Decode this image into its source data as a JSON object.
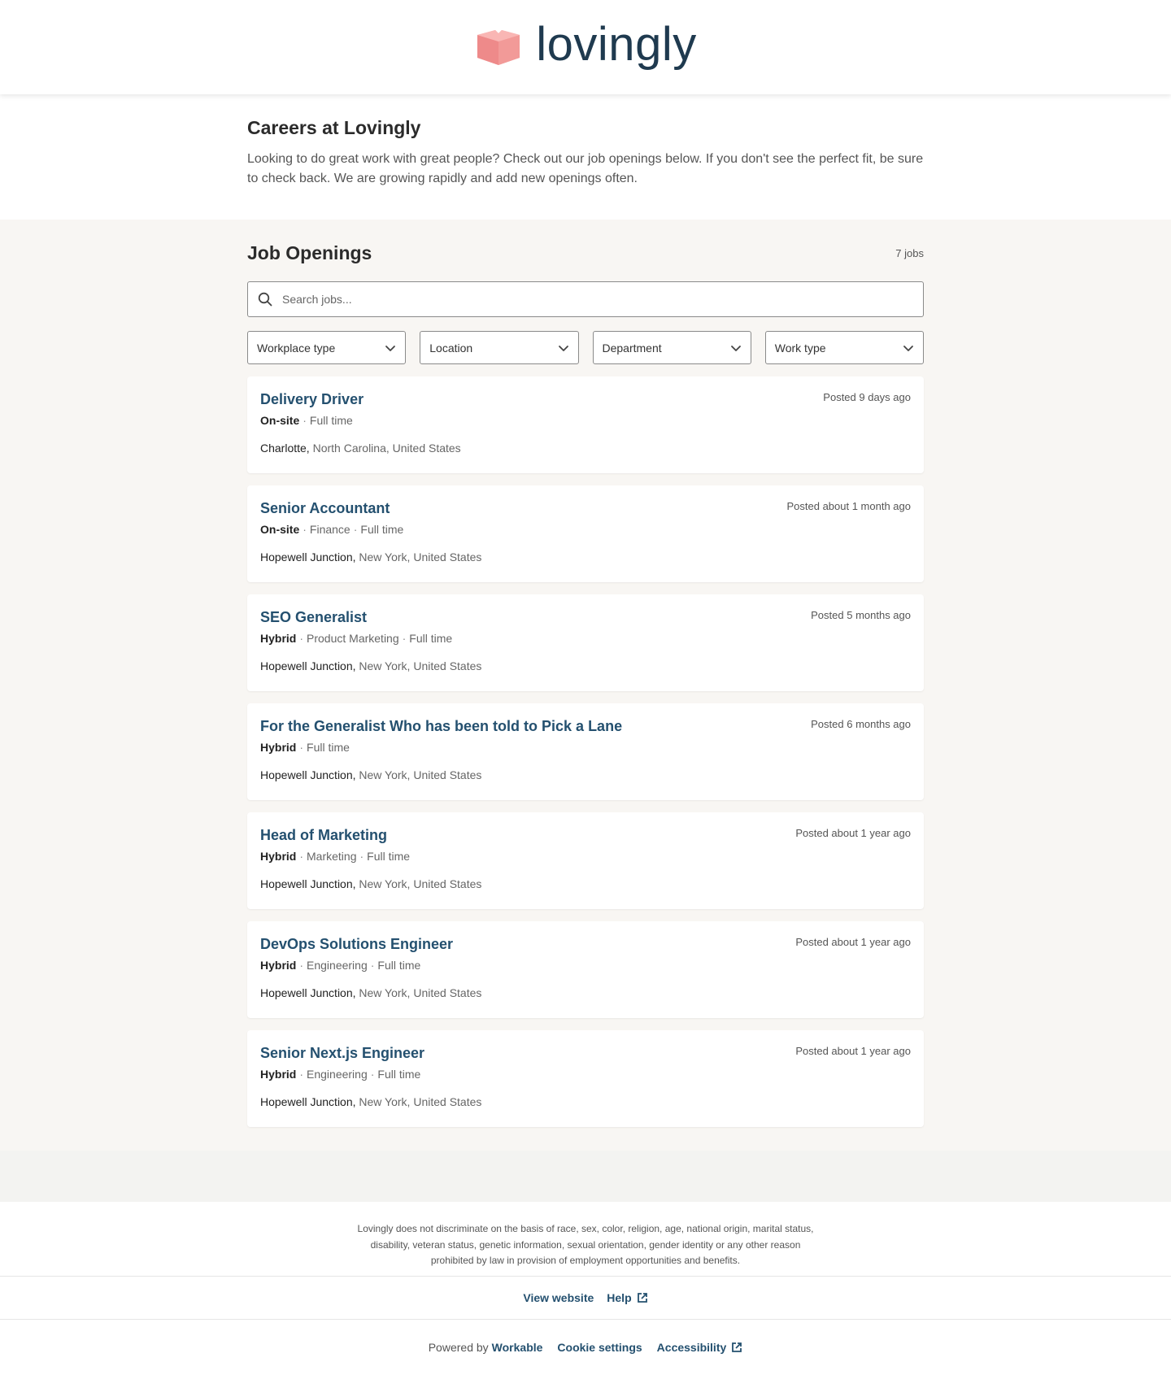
{
  "brand": {
    "name": "lovingly",
    "accent": "#f08d8d",
    "text_color": "#1f3a4f"
  },
  "intro": {
    "title": "Careers at Lovingly",
    "description": "Looking to do great work with great people? Check out our job openings below. If you don't see the perfect fit, be sure to check back. We are growing rapidly and add new openings often."
  },
  "openings": {
    "title": "Job Openings",
    "count": "7 jobs",
    "search_placeholder": "Search jobs...",
    "filters": [
      {
        "label": "Workplace type"
      },
      {
        "label": "Location"
      },
      {
        "label": "Department"
      },
      {
        "label": "Work type"
      }
    ],
    "jobs": [
      {
        "title": "Delivery Driver",
        "posted": "Posted 9 days ago",
        "workplace": "On-site",
        "tags": [
          "Full time"
        ],
        "city": "Charlotte,",
        "region": "North Carolina, United States"
      },
      {
        "title": "Senior Accountant",
        "posted": "Posted about 1 month ago",
        "workplace": "On-site",
        "tags": [
          "Finance",
          "Full time"
        ],
        "city": "Hopewell Junction,",
        "region": "New York, United States"
      },
      {
        "title": "SEO Generalist",
        "posted": "Posted 5 months ago",
        "workplace": "Hybrid",
        "tags": [
          "Product Marketing",
          "Full time"
        ],
        "city": "Hopewell Junction,",
        "region": "New York, United States"
      },
      {
        "title": "For the Generalist Who has been told to Pick a Lane",
        "posted": "Posted 6 months ago",
        "workplace": "Hybrid",
        "tags": [
          "Full time"
        ],
        "city": "Hopewell Junction,",
        "region": "New York, United States"
      },
      {
        "title": "Head of Marketing",
        "posted": "Posted about 1 year ago",
        "workplace": "Hybrid",
        "tags": [
          "Marketing",
          "Full time"
        ],
        "city": "Hopewell Junction,",
        "region": "New York, United States"
      },
      {
        "title": "DevOps Solutions Engineer",
        "posted": "Posted about 1 year ago",
        "workplace": "Hybrid",
        "tags": [
          "Engineering",
          "Full time"
        ],
        "city": "Hopewell Junction,",
        "region": "New York, United States"
      },
      {
        "title": "Senior Next.js Engineer",
        "posted": "Posted about 1 year ago",
        "workplace": "Hybrid",
        "tags": [
          "Engineering",
          "Full time"
        ],
        "city": "Hopewell Junction,",
        "region": "New York, United States"
      }
    ]
  },
  "footer": {
    "legal": "Lovingly does not discriminate on the basis of race, sex, color, religion, age, national origin, marital status, disability, veteran status, genetic information, sexual orientation, gender identity or any other reason prohibited by law in provision of employment opportunities and benefits.",
    "view_website": "View website",
    "help": "Help",
    "powered_by": "Powered by",
    "workable": "Workable",
    "cookie_settings": "Cookie settings",
    "accessibility": "Accessibility"
  }
}
